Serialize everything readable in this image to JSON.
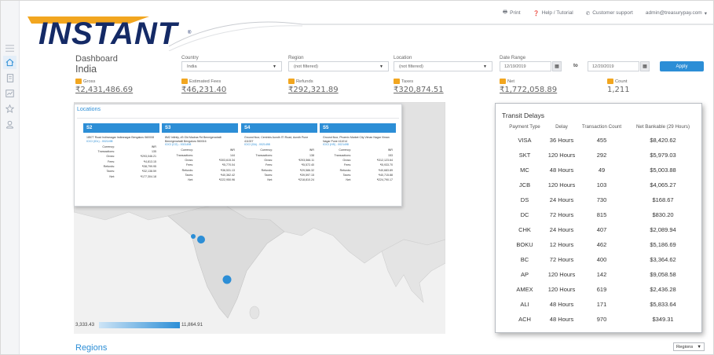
{
  "topbar": {
    "print_label": "Print",
    "help_label": "Help / Tutorial",
    "support_label": "Customer support",
    "account_label": "admin@treasurypay.com"
  },
  "brand": {
    "logo_text": "INSTANT",
    "logo_mark": "®",
    "color": "#142a66"
  },
  "header": {
    "title": "Dashboard",
    "subtitle": "India"
  },
  "filters": {
    "country": {
      "label": "Country",
      "value": "India"
    },
    "region": {
      "label": "Region",
      "value": "(not filtered)"
    },
    "location": {
      "label": "Location",
      "value": "(not filtered)"
    },
    "date_range": {
      "label": "Date Range",
      "start": "12/19/2019",
      "end": "12/20/2019",
      "to_label": "to"
    },
    "apply_label": "Apply"
  },
  "stats": [
    {
      "label": "Gross",
      "value": "₹2,431,486.69"
    },
    {
      "label": "Estimated Fees",
      "value": "₹46,231.40"
    },
    {
      "label": "Refunds",
      "value": "₹292,321.89"
    },
    {
      "label": "Taxes",
      "value": "₹320,874.51"
    },
    {
      "label": "Net",
      "value": "₹1,772,058.89"
    },
    {
      "label": "Count",
      "value": "1,211"
    }
  ],
  "locations": {
    "title": "Locations",
    "items": [
      {
        "name": "S2",
        "address": "18577 Road Indiranagar Indiranagar Bengaluru 560008",
        "link": "ICICI (IDL) - 0021498",
        "rows": [
          [
            "Currency:",
            "INR"
          ],
          [
            "Transactions:",
            "135"
          ],
          [
            "Gross:",
            "₹293,046.21"
          ],
          [
            "Fees:",
            "₹4,813.15"
          ],
          [
            "Refunds:",
            "₹38,799.95"
          ],
          [
            "Taxes:",
            "₹32,138.59"
          ],
          [
            "Net:",
            "₹177,304.18"
          ]
        ]
      },
      {
        "name": "S3",
        "address": "8M2 Infinity, #3 Old Madras Rd Bennigenahalli Bennigenahalli Bengaluru 560016",
        "link": "ICICI (CG) - 0021498",
        "rows": [
          [
            "Currency:",
            "INR"
          ],
          [
            "Transactions:",
            "144"
          ],
          [
            "Gross:",
            "₹303,615.34"
          ],
          [
            "Fees:",
            "₹5,770.04"
          ],
          [
            "Refunds:",
            "₹36,531.13"
          ],
          [
            "Taxes:",
            "₹40,362.42"
          ],
          [
            "Net:",
            "₹222,950.96"
          ]
        ]
      },
      {
        "name": "S4",
        "address": "Ground floor, Centrixis Aundh ITI Road, Aundh Pune 411007",
        "link": "ICICI (SA) - 0021498",
        "rows": [
          [
            "Currency:",
            "INR"
          ],
          [
            "Transactions:",
            "138"
          ],
          [
            "Gross:",
            "₹293,566.11"
          ],
          [
            "Fees:",
            "₹5,572.40"
          ],
          [
            "Refunds:",
            "₹29,586.32"
          ],
          [
            "Taxes:",
            "₹39,597.15"
          ],
          [
            "Net:",
            "₹218,810.24"
          ]
        ]
      },
      {
        "name": "S5",
        "address": "Ground floor, Phoenix Market City Viman Nagar Viman Nagar Pune 411014",
        "link": "ICICI (HS) - 0021498",
        "rows": [
          [
            "Currency:",
            "INR"
          ],
          [
            "Transactions:",
            "153"
          ],
          [
            "Gross:",
            "₹312,123.64"
          ],
          [
            "Fees:",
            "₹5,933.70"
          ],
          [
            "Refunds:",
            "₹40,683.89"
          ],
          [
            "Taxes:",
            "₹40,715.88"
          ],
          [
            "Net:",
            "₹224,790.17"
          ]
        ]
      }
    ]
  },
  "map": {
    "legend_min": "3,333.43",
    "legend_max": "11,864.91",
    "accent": "#2c8ed6"
  },
  "regions": {
    "title": "Regions",
    "select_value": "Regions"
  },
  "transit": {
    "title": "Transit Delays",
    "headers": [
      "Payment Type",
      "Delay",
      "Transaction Count",
      "Net Bankable (29 Hours)"
    ],
    "rows": [
      [
        "VISA",
        "36 Hours",
        "455",
        "$8,420.62"
      ],
      [
        "SKT",
        "120 Hours",
        "292",
        "$5,979.03"
      ],
      [
        "MC",
        "48 Hours",
        "49",
        "$5,003.88"
      ],
      [
        "JCB",
        "120 Hours",
        "103",
        "$4,065.27"
      ],
      [
        "DS",
        "24 Hours",
        "730",
        "$168.67"
      ],
      [
        "DC",
        "72 Hours",
        "815",
        "$830.20"
      ],
      [
        "CHK",
        "24 Hours",
        "407",
        "$2,089.94"
      ],
      [
        "BOKU",
        "12 Hours",
        "462",
        "$5,186.69"
      ],
      [
        "BC",
        "72 Hours",
        "400",
        "$3,364.62"
      ],
      [
        "AP",
        "120 Hours",
        "142",
        "$9,058.58"
      ],
      [
        "AMEX",
        "120 Hours",
        "619",
        "$2,436.28"
      ],
      [
        "ALI",
        "48 Hours",
        "171",
        "$5,833.64"
      ],
      [
        "ACH",
        "48 Hours",
        "970",
        "$349.31"
      ]
    ]
  },
  "sidebar": {
    "icons": [
      "home-icon",
      "document-icon",
      "chart-icon",
      "star-icon",
      "user-icon"
    ]
  }
}
